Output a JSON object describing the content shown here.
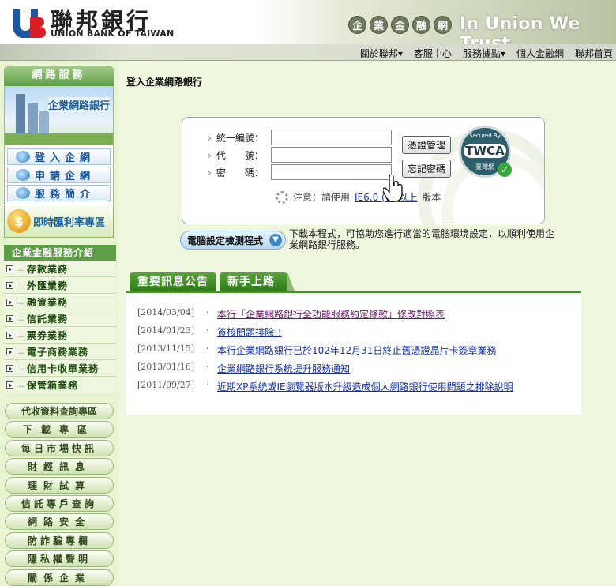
{
  "header": {
    "bank_name_cn": "聯邦銀行",
    "bank_name_en": "UNION BANK OF TAIWAN",
    "circles": [
      "企",
      "業",
      "金",
      "融",
      "網"
    ],
    "slogan": "In Union We Trust"
  },
  "topnav": [
    "關於聯邦▾",
    "客服中心",
    "服務據點▾",
    "個人金融網",
    "聯邦首頁"
  ],
  "sidebar": {
    "net_service_title": "網路服務",
    "banner_text": "企業網路銀行",
    "service_buttons": [
      "登入企網",
      "申請企網",
      "服務簡介"
    ],
    "fx_icon": "$",
    "fx_label": "即時匯利率專區",
    "biz_title": "企業金融服務介紹",
    "biz_items": [
      "存款業務",
      "外匯業務",
      "融資業務",
      "信託業務",
      "票券業務",
      "電子商務業務",
      "信用卡收單業務",
      "保管箱業務"
    ],
    "pills": [
      "代收資料查詢專區",
      "下載專區",
      "每日市場快訊",
      "財經訊息",
      "理財試算",
      "信託專戶查詢",
      "網路安全",
      "防詐騙專欄",
      "隱私權聲明",
      "關係企業"
    ]
  },
  "main": {
    "title": "登入企業網路銀行",
    "login": {
      "fields": [
        {
          "label": "統一編號",
          "value": ""
        },
        {
          "label": "代　　號",
          "value": ""
        },
        {
          "label": "密　　碼",
          "value": ""
        }
      ],
      "cert_button": "憑證管理",
      "forgot_button": "忘記密碼",
      "note_prefix": "注意：請使用",
      "note_link": "IE6.0 (含)以上",
      "note_suffix": "版本",
      "seal": {
        "top": "Secured By",
        "mid": "TWCA",
        "bottom": "臺灣網"
      }
    },
    "check_button": "電腦設定檢測程式",
    "check_desc": "下載本程式，可協助您進行適當的電腦環境設定，以順利使用企業網路銀行服務。",
    "tabs": [
      "重要訊息公告",
      "新手上路"
    ],
    "news": [
      {
        "date": "[2014/03/04]",
        "title": "本行「企業網路銀行全功能服務約定條款」修改對照表"
      },
      {
        "date": "[2014/01/23]",
        "title": "簽核問題排除!!"
      },
      {
        "date": "[2013/11/15]",
        "title": "本行企業網路銀行已於102年12月31日終止舊憑證晶片卡簽章業務"
      },
      {
        "date": "[2013/01/16]",
        "title": "企業網路銀行系統提升服務通知"
      },
      {
        "date": "[2011/09/27]",
        "title": "近期XP系統或IE瀏覽器版本升級造成個人網路銀行使用問題之排除說明"
      }
    ]
  }
}
